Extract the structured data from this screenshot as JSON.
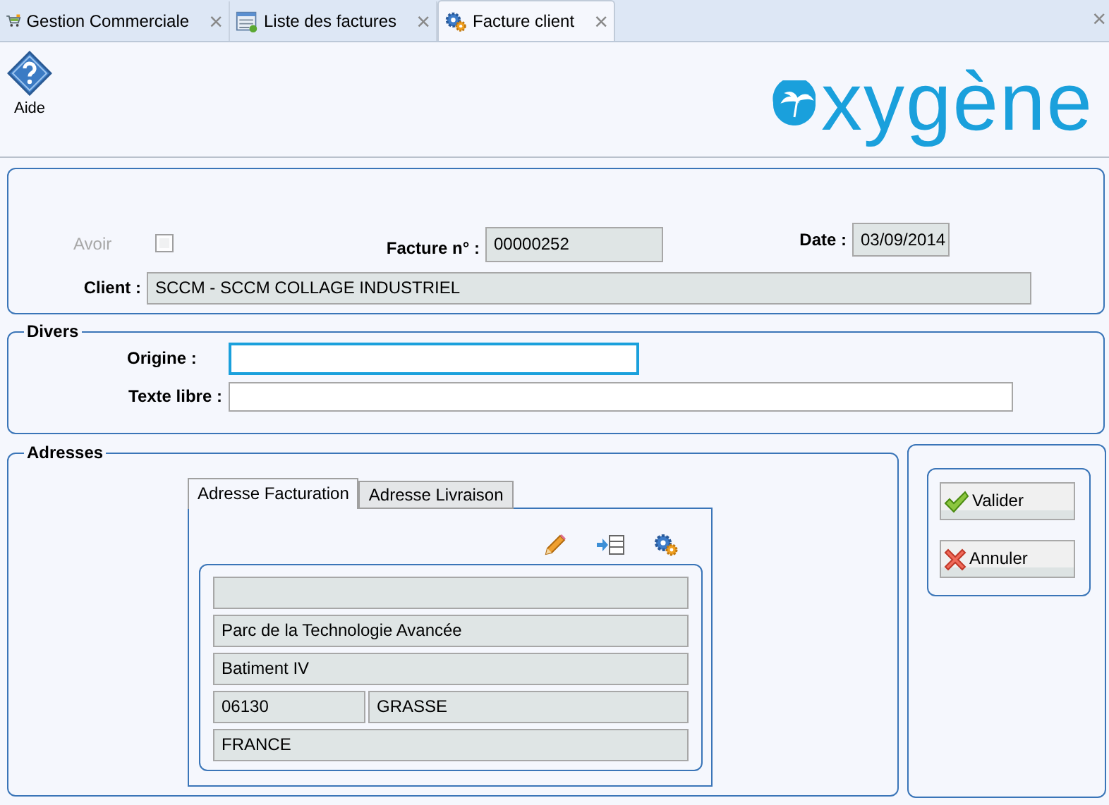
{
  "tabs": [
    {
      "label": "Gestion Commerciale",
      "close": "×",
      "selected": false
    },
    {
      "label": "Liste des factures",
      "close": "×",
      "selected": false
    },
    {
      "label": "Facture client",
      "close": "×",
      "selected": true
    }
  ],
  "tabbar_close": "×",
  "toolbar": {
    "buttons": [
      {
        "label": "Aide"
      }
    ]
  },
  "logo": {
    "text": "xygène"
  },
  "header": {
    "avoir": {
      "label": "Avoir",
      "disabled": true,
      "checked": false
    },
    "facture": {
      "label": "Facture n° :",
      "value": "00000252"
    },
    "date": {
      "label": "Date :",
      "value": "03/09/2014"
    },
    "client": {
      "label": "Client :",
      "value": "SCCM - SCCM COLLAGE INDUSTRIEL"
    }
  },
  "divers": {
    "legend": "Divers",
    "fields": [
      {
        "label": "Origine :",
        "focused": true
      },
      {
        "label": "Texte libre :",
        "focused": false
      }
    ]
  },
  "adresses": {
    "legend": "Adresses",
    "tabs": [
      {
        "label": "Adresse Facturation",
        "selected": true
      },
      {
        "label": "Adresse Livraison",
        "selected": false
      }
    ],
    "rows": [
      {
        "kind": "blank"
      },
      {
        "kind": "line",
        "values": [
          "Parc de la Technologie Avancée"
        ]
      },
      {
        "kind": "line",
        "values": [
          "Batiment IV"
        ]
      },
      {
        "kind": "split",
        "values": [
          "06130",
          "GRASSE"
        ]
      },
      {
        "kind": "line",
        "values": [
          "FRANCE"
        ]
      }
    ]
  },
  "actions": [
    {
      "label": "Valider",
      "kind": "ok"
    },
    {
      "label": "Annuler",
      "kind": "cancel"
    }
  ]
}
